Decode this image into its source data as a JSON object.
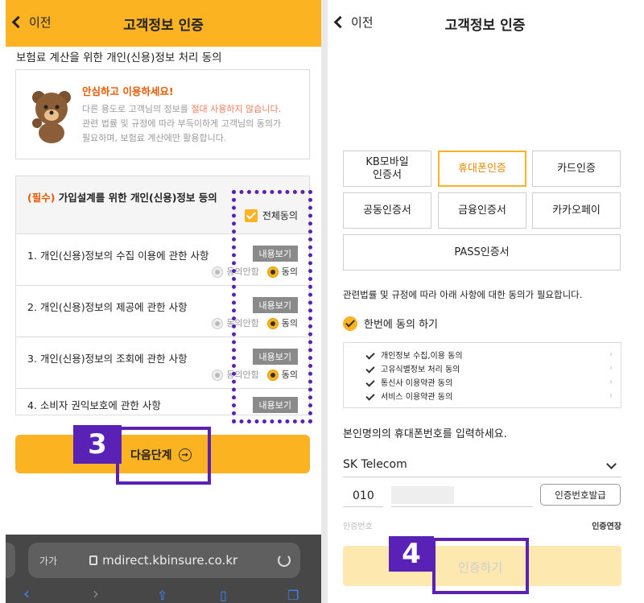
{
  "left": {
    "header": {
      "back_label": "이전",
      "title": "고객정보 인증"
    },
    "section_title": "보험료 계산을 위한 개인(신용)정보 처리 동의",
    "notice": {
      "title": "안심하고 이용하세요!",
      "line1_pre": "다른 용도로 고객님의 정보를 ",
      "line1_hl": "절대 사용하지 않습니다.",
      "line2": "관련 법률 및 규정에 따라 부득이하게 고객님의 동의가",
      "line3": "필요하며, 보험료 계산에만 활용합니다."
    },
    "agree": {
      "required_tag": "(필수)",
      "title": " 가입설계를 위한 개인(신용)정보 등의",
      "all_agree": "전체동의",
      "items": [
        {
          "label": "1. 개인(신용)정보의 수집 이용에 관한 사항",
          "view": "내용보기",
          "disagree": "동의안함",
          "agree": "동의"
        },
        {
          "label": "2. 개인(신용)정보의 제공에 관한 사항",
          "view": "내용보기",
          "disagree": "동의안함",
          "agree": "동의"
        },
        {
          "label": "3. 개인(신용)정보의 조회에 관한 사항",
          "view": "내용보기",
          "disagree": "동의안함",
          "agree": "동의"
        },
        {
          "label": "4. 소비자 권익보호에 관한 사항",
          "view": "내용보기"
        }
      ]
    },
    "step_badge": "3",
    "next_button": "다음단계",
    "next_icon": "→",
    "browser": {
      "aa": "가가",
      "url": "mdirect.kbinsure.co.kr"
    }
  },
  "right": {
    "header": {
      "back_label": "이전",
      "title": "고객정보 인증"
    },
    "auth_methods": [
      "KB모바일\n인증서",
      "휴대폰인증",
      "카드인증",
      "공동인증서",
      "금융인증서",
      "카카오페이",
      "PASS인증서"
    ],
    "notice": "관련법률 및 규정에 따라 아래 사항에 대한 동의가 필요합니다.",
    "agree_all": "한번에 동의 하기",
    "agree_items": [
      "개인정보 수집,이용 동의",
      "고유식별정보 처리 동의",
      "통신사 이용약관 동의",
      "서비스 이용약관 동의"
    ],
    "phone_prompt": "본인명의의 휴대폰번호를 입력하세요.",
    "carrier": "SK Telecom",
    "prefix": "010",
    "issue_button": "인증번호발급",
    "cert_label": "인증번호",
    "cert_timer": "인증연장",
    "step_badge": "4",
    "auth_button": "인증하기"
  },
  "colors": {
    "brand": "#fbb321",
    "annotation": "#5a21b7",
    "warning": "#e85a00"
  }
}
